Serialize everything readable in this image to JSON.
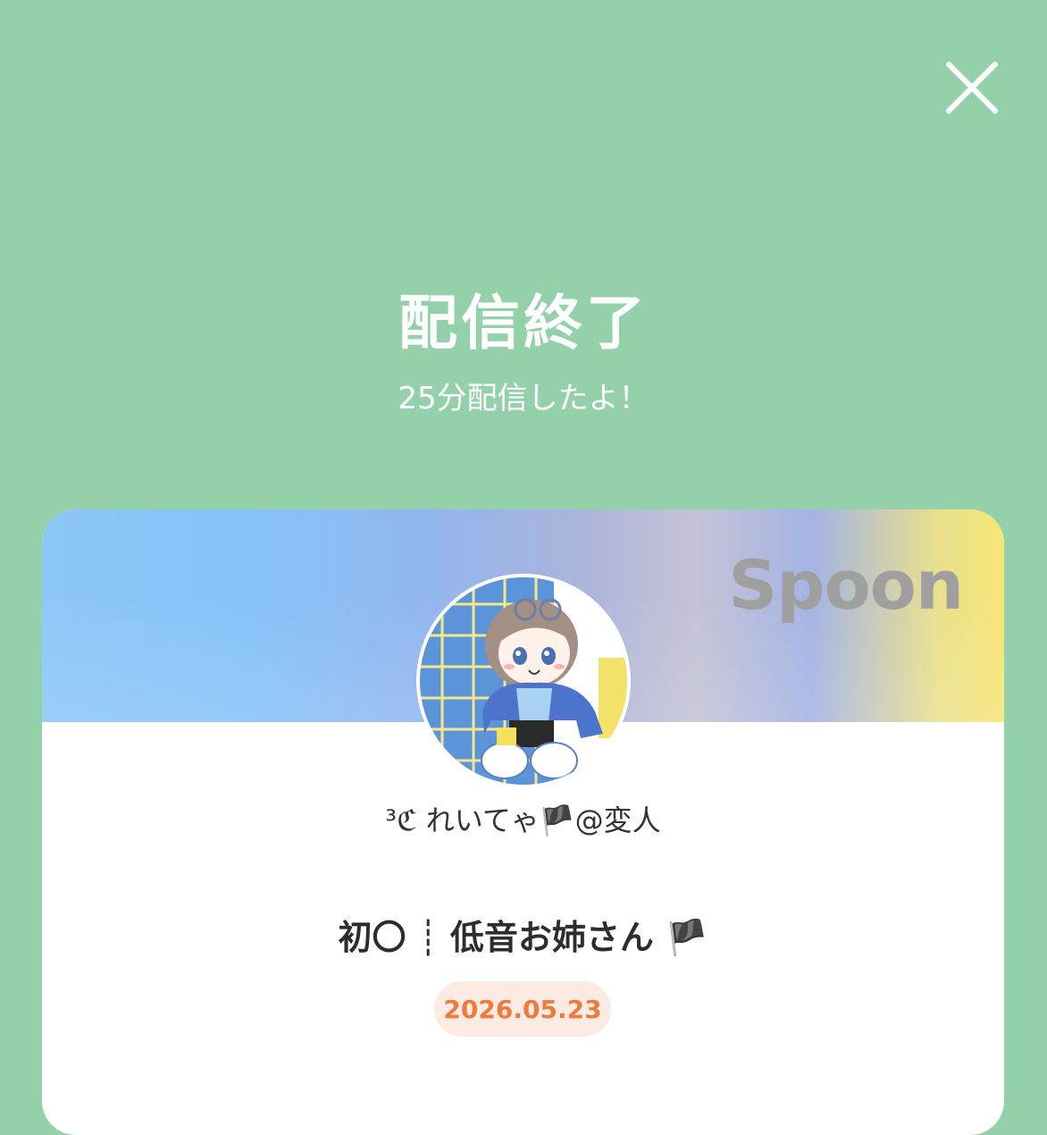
{
  "header": {
    "close_icon": "close-icon"
  },
  "result": {
    "title": "配信終了",
    "subtitle": "25分配信したよ！"
  },
  "card": {
    "brand": "Spoon",
    "username": "³ℭ れいてゃ🏴@変人",
    "stream_title": "初〇 ┊ 低音お姉さん 🏴",
    "date": "2026.05.23",
    "colors": {
      "background": "#94d1ab",
      "date_text": "#ee7a3d",
      "date_badge": "#fcebe3"
    }
  }
}
